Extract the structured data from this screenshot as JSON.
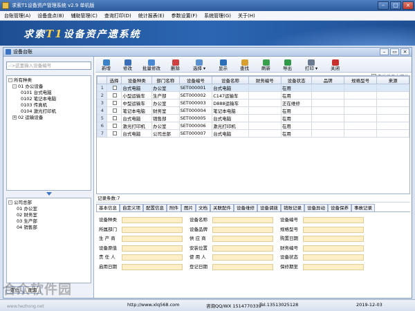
{
  "window": {
    "title": "求索T1设备资产管理系统 v2.9 单机版"
  },
  "menu": [
    "台账管理(A)",
    "设备盘点(B)",
    "辅助管理(C)",
    "查询打印(D)",
    "统计报表(E)",
    "参数设置(F)",
    "系统管理(G)",
    "关于(H)"
  ],
  "banner": {
    "prefix": "求索",
    "brand": "T1",
    "suffix": "设备资产遗系统"
  },
  "panel": {
    "title": "设备台账"
  },
  "left": {
    "search_placeholder": "-->这里输入设备编号",
    "tree_type": [
      {
        "label": "所有种类",
        "sign": "-"
      },
      {
        "label": "01 办公设备",
        "sign": "-"
      },
      {
        "label": "0101 台式电脑",
        "sign": ""
      },
      {
        "label": "0102 笔记本电脑",
        "sign": ""
      },
      {
        "label": "0103 传真机",
        "sign": ""
      },
      {
        "label": "0104 激光打印机",
        "sign": ""
      },
      {
        "label": "02 运输设备",
        "sign": "+"
      }
    ],
    "tree_dept": [
      {
        "label": "公司总部",
        "sign": "-"
      },
      {
        "label": "01 办公室",
        "sign": ""
      },
      {
        "label": "02 财务室",
        "sign": ""
      },
      {
        "label": "03 生产部",
        "sign": ""
      },
      {
        "label": "04 销售部",
        "sign": ""
      }
    ],
    "tabs": [
      "定位",
      "查询"
    ]
  },
  "toolbar": {
    "buttons": [
      "新增",
      "修改",
      "批量修改",
      "删除",
      "选择",
      "显示",
      "查找",
      "刷新",
      "导出",
      "打印",
      "关闭"
    ],
    "auto_show_label": "启动显示本窗体"
  },
  "table": {
    "columns": [
      "",
      "选择",
      "设备种类",
      "部门名称",
      "设备编号",
      "设备名称",
      "财务编号",
      "设备状态",
      "品牌",
      "规格型号",
      "来源"
    ],
    "rows": [
      [
        "1",
        "",
        "台式电脑",
        "办公室",
        "SET000001",
        "台式电脑",
        "",
        "在用",
        "",
        "",
        ""
      ],
      [
        "2",
        "",
        "小型运输车",
        "生产部",
        "SET000002",
        "C147运输车",
        "",
        "在用",
        "",
        "",
        ""
      ],
      [
        "3",
        "",
        "中型运输车",
        "办公室",
        "SET000003",
        "D888运输车",
        "",
        "正在维修",
        "",
        "",
        ""
      ],
      [
        "4",
        "",
        "笔记本电脑",
        "财务室",
        "SET000004",
        "笔记本电脑",
        "",
        "在用",
        "",
        "",
        ""
      ],
      [
        "5",
        "",
        "台式电脑",
        "销售部",
        "SET000005",
        "台式电脑",
        "",
        "在用",
        "",
        "",
        ""
      ],
      [
        "6",
        "",
        "激光打印机",
        "办公室",
        "SET000006",
        "激光打印机",
        "",
        "在用",
        "",
        "",
        ""
      ],
      [
        "7",
        "",
        "台式电脑",
        "公司总部",
        "SET000007",
        "台式电脑",
        "",
        "在用",
        "",
        "",
        ""
      ]
    ]
  },
  "record_count": "记录条数:7",
  "detail_tabs": [
    "基本信息",
    "自定义项",
    "配置信息",
    "附件",
    "图片",
    "文档",
    "关联配件",
    "设备维修",
    "设备调拨",
    "销账记录",
    "设备异动",
    "设备保养",
    "事故记录"
  ],
  "fields": {
    "col1": [
      "设备种类",
      "所属部门",
      "生 产 商",
      "设备原值",
      "责 任 人",
      "启用日期"
    ],
    "col2": [
      "设备名称",
      "设备品牌",
      "供 应 商",
      "安装位置",
      "使 用 人",
      "登记日期"
    ],
    "col3": [
      "设备编号",
      "规格型号",
      "购置日期",
      "财务编号",
      "设备状态",
      "保修期至"
    ]
  },
  "status": {
    "site": "http://www.xlq568.com",
    "qq": "咨询QQ/WX 1514770339",
    "tel": "Tel.13513025128",
    "date": "2019-12-03"
  },
  "watermark": {
    "cn": "合众软件园",
    "en": "www.hezhong.net"
  }
}
